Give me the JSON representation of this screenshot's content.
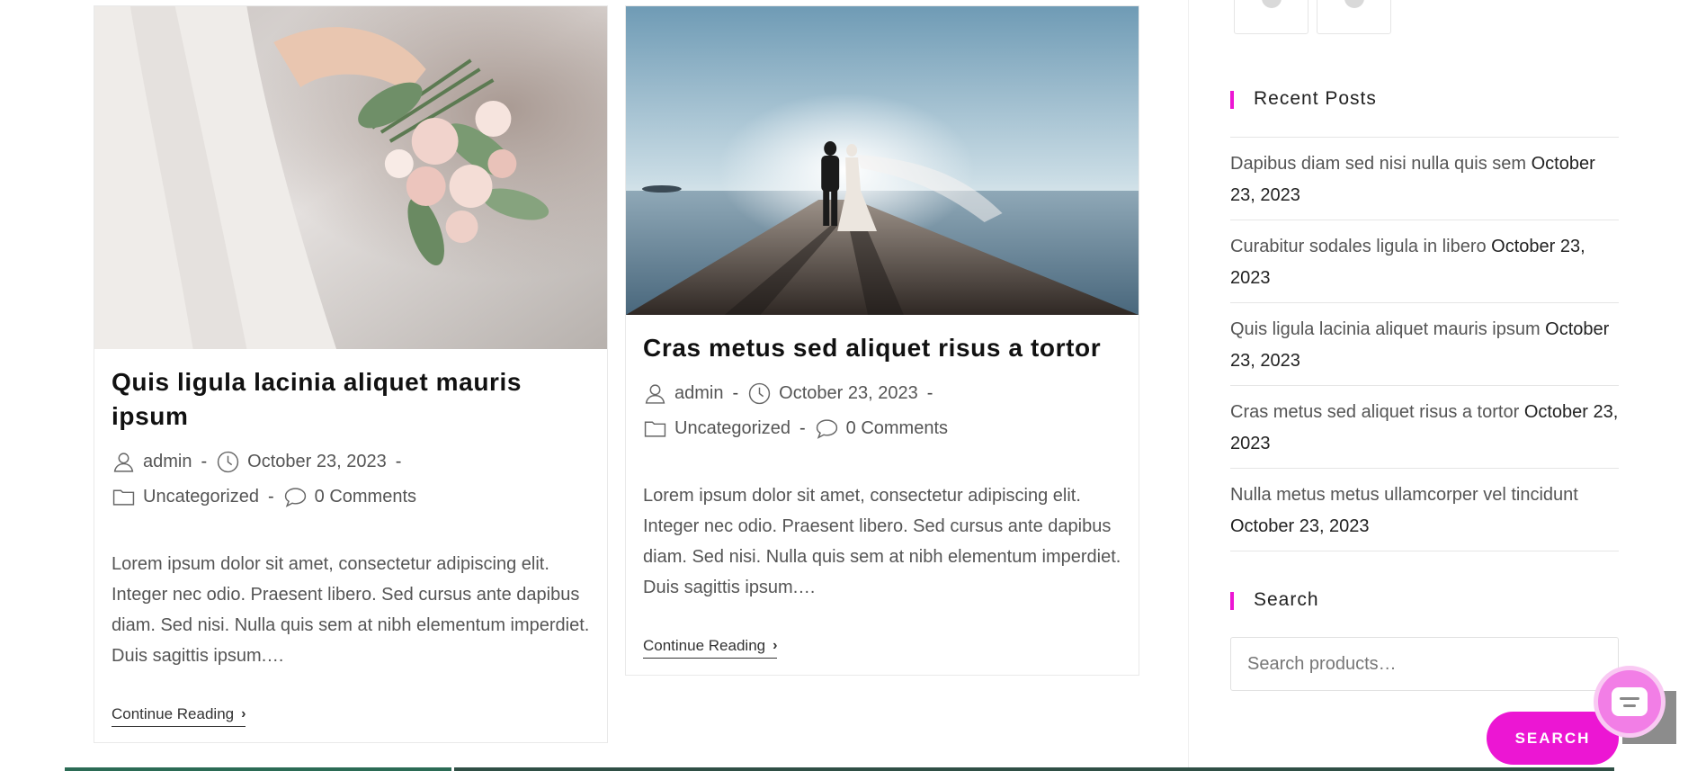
{
  "posts": [
    {
      "title": "Quis ligula lacinia aliquet mauris ipsum",
      "author": "admin",
      "date": "October 23, 2023",
      "category": "Uncategorized",
      "comments": "0 Comments",
      "excerpt": "Lorem ipsum dolor sit amet, consectetur adipiscing elit. Integer nec odio. Praesent libero. Sed cursus ante dapibus diam. Sed nisi. Nulla quis sem at nibh elementum imperdiet. Duis sagittis ipsum.…",
      "continue": "Continue Reading"
    },
    {
      "title": "Cras metus sed aliquet risus a tortor",
      "author": "admin",
      "date": "October 23, 2023",
      "category": "Uncategorized",
      "comments": "0 Comments",
      "excerpt": "Lorem ipsum dolor sit amet, consectetur adipiscing elit. Integer nec odio. Praesent libero. Sed cursus ante dapibus diam. Sed nisi. Nulla quis sem at nibh elementum imperdiet. Duis sagittis ipsum.…",
      "continue": "Continue Reading"
    }
  ],
  "sidebar": {
    "recent_title": "Recent Posts",
    "recent_posts": [
      {
        "title": "Dapibus diam sed nisi nulla quis sem",
        "date": "October 23, 2023"
      },
      {
        "title": "Curabitur sodales ligula in libero",
        "date": "October 23, 2023"
      },
      {
        "title": "Quis ligula lacinia aliquet mauris ipsum",
        "date": "October 23, 2023"
      },
      {
        "title": "Cras metus sed aliquet risus a tortor",
        "date": "October 23, 2023"
      },
      {
        "title": "Nulla metus metus ullamcorper vel tincidunt",
        "date": "October 23, 2023"
      }
    ],
    "search_title": "Search",
    "search_placeholder": "Search products…",
    "search_button": "SEARCH"
  },
  "colors": {
    "accent": "#ec16d3",
    "chat": "#f27ee6"
  },
  "icons": [
    "user-icon",
    "clock-icon",
    "folder-icon",
    "comment-icon",
    "chevron-right-icon",
    "chat-icon"
  ]
}
